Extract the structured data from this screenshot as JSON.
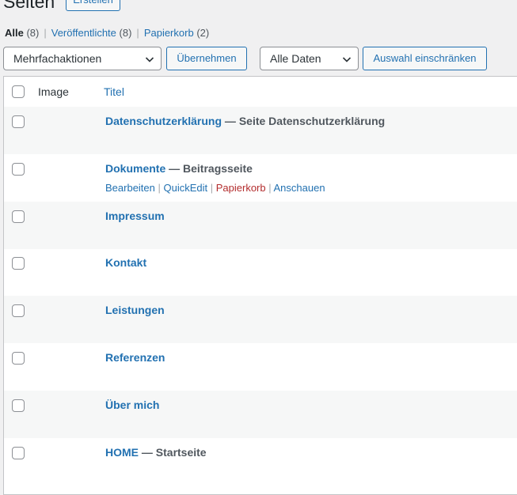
{
  "header": {
    "title": "Seiten",
    "add_button": "Erstellen"
  },
  "filters": [
    {
      "label": "Alle",
      "count": "(8)"
    },
    {
      "label": "Veröffentlichte",
      "count": "(8)"
    },
    {
      "label": "Papierkorb",
      "count": "(2)"
    }
  ],
  "tablenav": {
    "bulk_select": "Mehrfachaktionen",
    "apply_button": "Übernehmen",
    "date_select": "Alle Daten",
    "filter_button": "Auswahl einschränken"
  },
  "columns": {
    "image": "Image",
    "title": "Titel"
  },
  "rows": [
    {
      "title": "Datenschutzerklärung",
      "state": " — Seite Datenschutzerklärung"
    },
    {
      "title": "Dokumente",
      "state": " — Beitragsseite"
    },
    {
      "title": "Impressum",
      "state": ""
    },
    {
      "title": "Kontakt",
      "state": ""
    },
    {
      "title": "Leistungen",
      "state": ""
    },
    {
      "title": "Referenzen",
      "state": ""
    },
    {
      "title": "Über mich",
      "state": ""
    },
    {
      "title": "HOME",
      "state": " — Startseite"
    }
  ],
  "row_actions": {
    "edit": "Bearbeiten",
    "quick_edit": "QuickEdit",
    "trash": "Papierkorb",
    "view": "Anschauen"
  },
  "colors": {
    "link": "#2271b1",
    "trash": "#b32d2e",
    "alt_row": "#f6f7f7",
    "background": "#f0f0f1"
  }
}
